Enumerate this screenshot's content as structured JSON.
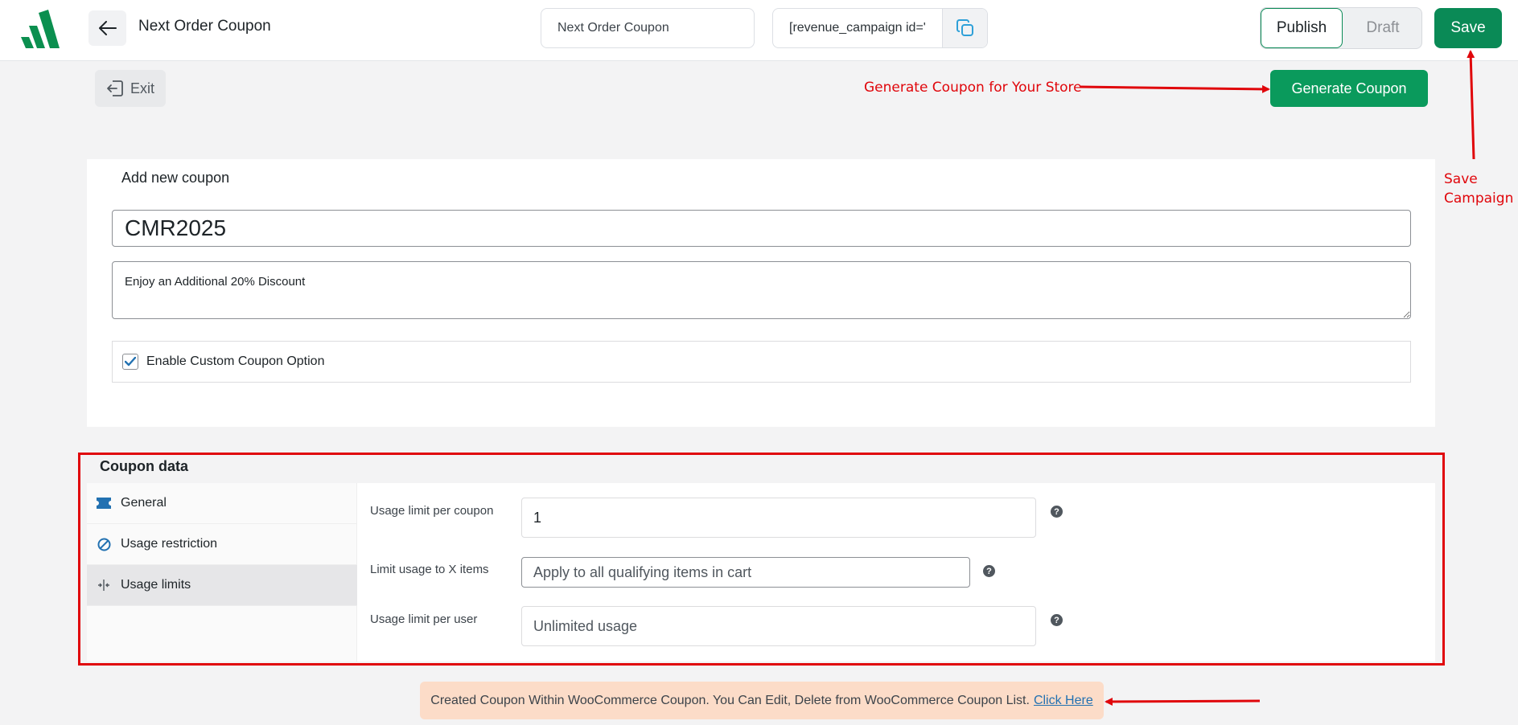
{
  "header": {
    "title": "Next Order Coupon",
    "campaign_name_value": "Next Order Coupon",
    "shortcode_value": "[revenue_campaign id='",
    "publish_label": "Publish",
    "draft_label": "Draft",
    "save_label": "Save"
  },
  "toolbar": {
    "exit_label": "Exit",
    "generate_label": "Generate Coupon"
  },
  "annotations": {
    "generate_note": "Generate Coupon for Your Store",
    "save_note_line1": "Save",
    "save_note_line2": "Campaign"
  },
  "coupon_form": {
    "heading": "Add new coupon",
    "code_value": "CMR2025",
    "description_value": "Enjoy an Additional 20% Discount",
    "custom_option_label": "Enable Custom Coupon Option",
    "custom_option_checked": true
  },
  "coupon_data": {
    "title": "Coupon data",
    "tabs": [
      {
        "label": "General",
        "icon": "ticket-icon"
      },
      {
        "label": "Usage restriction",
        "icon": "prohibited-icon"
      },
      {
        "label": "Usage limits",
        "icon": "limits-icon",
        "active": true
      }
    ],
    "fields": {
      "per_coupon_label": "Usage limit per coupon",
      "per_coupon_value": "1",
      "x_items_label": "Limit usage to X items",
      "x_items_placeholder": "Apply to all qualifying items in cart",
      "per_user_label": "Usage limit per user",
      "per_user_placeholder": "Unlimited usage"
    }
  },
  "notice": {
    "text": "Created Coupon Within WooCommerce Coupon. You Can Edit, Delete from WooCommerce Coupon List.",
    "link_label": "Click Here"
  },
  "colors": {
    "brand_green": "#0a8a56",
    "annotation_red": "#e0060b",
    "notice_bg": "#fcdcc8"
  }
}
